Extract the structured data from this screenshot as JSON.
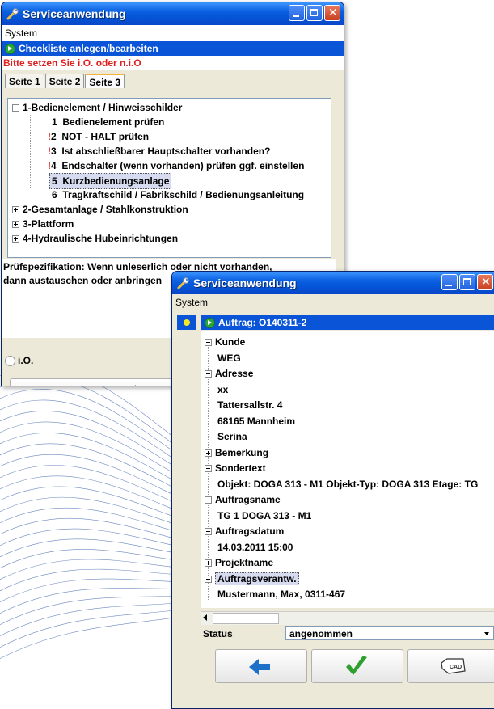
{
  "colors": {
    "titlebar": "#0a5fe0",
    "selection_bar": "#0a54d8",
    "warning_text": "#e02020",
    "arrow_blue": "#1e6fc8",
    "check_green": "#2fa02f"
  },
  "window1": {
    "title": "Serviceanwendung",
    "menu": "System",
    "header": "Checkliste anlegen/bearbeiten",
    "warning": "Bitte setzen Sie i.O. oder n.i.O",
    "tabs": [
      {
        "label": "Seite 1"
      },
      {
        "label": "Seite 2"
      },
      {
        "label": "Seite 3",
        "active": true
      }
    ],
    "tree": {
      "group1": "1-Bedienelement / Hinweisschilder",
      "items": [
        {
          "num": "1",
          "label": "Bedienelement prüfen",
          "flag": ""
        },
        {
          "num": "2",
          "label": "NOT - HALT prüfen",
          "flag": "!"
        },
        {
          "num": "3",
          "label": "Ist abschließbarer Hauptschalter vorhanden?",
          "flag": "!"
        },
        {
          "num": "4",
          "label": "Endschalter (wenn vorhanden) prüfen ggf. einstellen",
          "flag": "!"
        },
        {
          "num": "5",
          "label": "Kurzbedienungsanlage",
          "flag": "",
          "selected": true
        },
        {
          "num": "6",
          "label": "Tragkraftschild / Fabrikschild / Bedienungsanleitung",
          "flag": ""
        }
      ],
      "group2": "2-Gesamtanlage / Stahlkonstruktion",
      "group3": "3-Plattform",
      "group4": "4-Hydraulische Hubeinrichtungen"
    },
    "spec_line1": "Prüfspezifikation: Wenn unleserlich oder nicht vorhanden,",
    "spec_line2": "dann austauschen oder anbringen",
    "radio_label": "i.O.",
    "back_icon": "arrow-left-icon"
  },
  "window2": {
    "title": "Serviceanwendung",
    "menu": "System",
    "order": "Auftrag: O140311-2",
    "rows": [
      {
        "label": "Kunde",
        "level": 0,
        "expander": "minus"
      },
      {
        "label": "WEG",
        "level": 1
      },
      {
        "label": "Adresse",
        "level": 0,
        "expander": "minus"
      },
      {
        "label": "xx",
        "level": 1
      },
      {
        "label": "Tattersallstr. 4",
        "level": 1
      },
      {
        "label": "68165 Mannheim",
        "level": 1
      },
      {
        "label": "Serina",
        "level": 1
      },
      {
        "label": "Bemerkung",
        "level": 0,
        "expander": "plus"
      },
      {
        "label": "Sondertext",
        "level": 0,
        "expander": "minus"
      },
      {
        "label": "Objekt: DOGA 313 - M1 Objekt-Typ: DOGA 313 Etage: TG",
        "level": 1
      },
      {
        "label": "Auftragsname",
        "level": 0,
        "expander": "minus"
      },
      {
        "label": "TG 1  DOGA 313 - M1",
        "level": 1
      },
      {
        "label": "Auftragsdatum",
        "level": 0,
        "expander": "minus"
      },
      {
        "label": "14.03.2011 15:00",
        "level": 1
      },
      {
        "label": "Projektname",
        "level": 0,
        "expander": "plus"
      },
      {
        "label": "Auftragsverantw.",
        "level": 0,
        "expander": "minus",
        "selected": true
      },
      {
        "label": "Mustermann, Max, 0311-467",
        "level": 1
      }
    ],
    "status_label": "Status",
    "status_value": "angenommen",
    "buttons": {
      "back_icon": "arrow-left-icon",
      "ok_icon": "checkmark-icon",
      "cad_icon": "cad-hand-icon",
      "cad_text": "CAD"
    }
  }
}
